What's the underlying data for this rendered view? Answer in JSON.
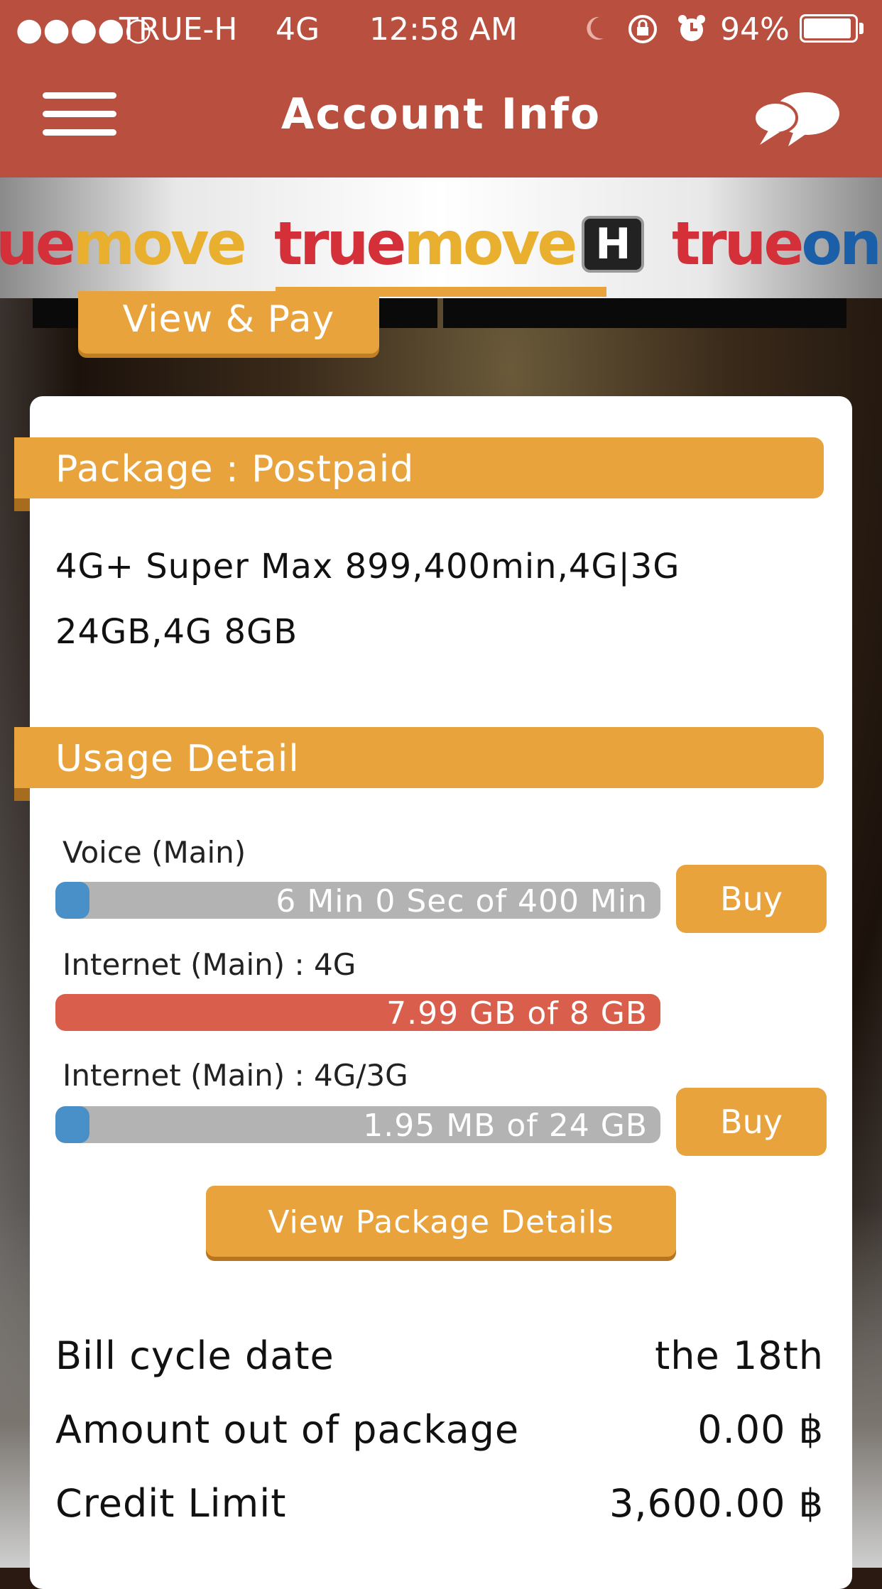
{
  "status_bar": {
    "signal": "●●●●○",
    "carrier": "TRUE-H",
    "network": "4G",
    "time": "12:58 AM",
    "battery_percent": "94%",
    "battery_level": 0.94
  },
  "header": {
    "title": "Account Info",
    "menu_icon": "hamburger-menu-icon",
    "chat_icon": "chat-bubbles-icon"
  },
  "brand_tabs": {
    "left_partial": [
      "ue",
      "move"
    ],
    "center": [
      "true",
      "move"
    ],
    "center_badge": "H",
    "right_partial": [
      "true",
      "onl"
    ]
  },
  "view_pay_button": "View & Pay",
  "package": {
    "section_title": "Package : Postpaid",
    "line1": "4G+ Super Max 899,400min,4G|3G",
    "line2": "24GB,4G 8GB"
  },
  "usage": {
    "section_title": "Usage Detail",
    "items": [
      {
        "label": "Voice (Main)",
        "value_text": "6 Min 0 Sec of 400 Min",
        "used_fraction": 0.015,
        "buy_label": "Buy"
      },
      {
        "label": "Internet (Main) :   4G",
        "value_text": "7.99 GB  of  8 GB",
        "used_fraction": 0.999
      },
      {
        "label": "Internet (Main) :   4G/3G",
        "value_text": "1.95 MB  of  24 GB",
        "used_fraction": 0.0001,
        "buy_label": "Buy"
      }
    ],
    "view_details_button": "View Package Details"
  },
  "billing": [
    {
      "label": "Bill cycle date",
      "value": "the 18th"
    },
    {
      "label": "Amount out of package",
      "value": "0.00 ฿"
    },
    {
      "label": "Credit Limit",
      "value": "3,600.00 ฿"
    }
  ],
  "colors": {
    "header": "#b84f3f",
    "accent": "#e8a33c",
    "progress_blue": "#4a90c8",
    "progress_red": "#d95f4c",
    "track_gray": "#b3b3b3"
  }
}
